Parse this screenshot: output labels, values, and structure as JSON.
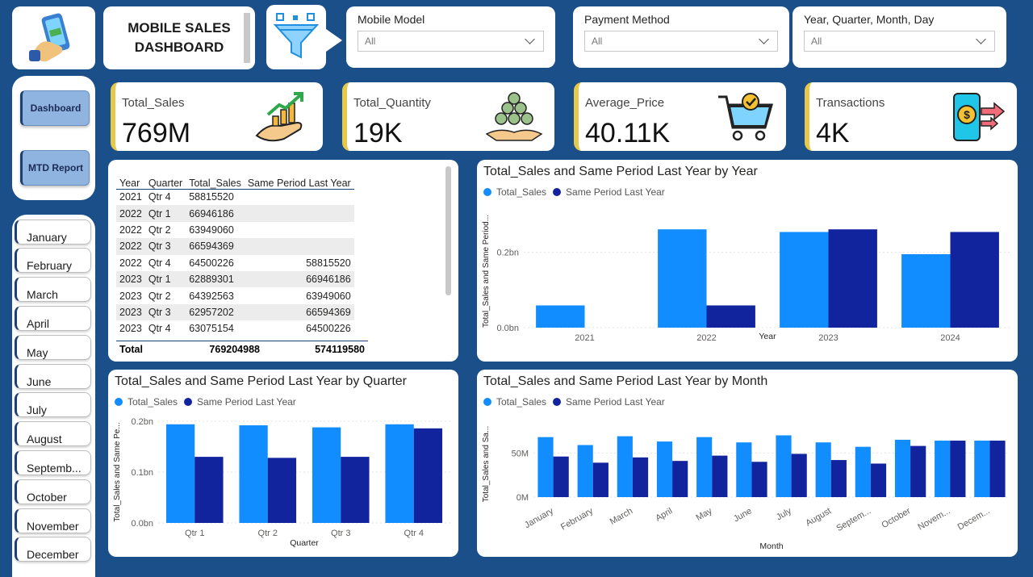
{
  "header": {
    "title_line1": "MOBILE SALES",
    "title_line2": "DASHBOARD"
  },
  "slicers": [
    {
      "label": "Mobile Model",
      "value": "All"
    },
    {
      "label": "Payment Method",
      "value": "All"
    },
    {
      "label": "Year, Quarter, Month, Day",
      "value": "All"
    }
  ],
  "nav": {
    "dashboard_label": "Dashboard",
    "mtd_label": "MTD Report"
  },
  "months": [
    "January",
    "February",
    "March",
    "April",
    "May",
    "June",
    "July",
    "August",
    "Septemb...",
    "October",
    "November",
    "December"
  ],
  "kpis": [
    {
      "label": "Total_Sales",
      "value": "769M",
      "icon": "hand-growth-icon"
    },
    {
      "label": "Total_Quantity",
      "value": "19K",
      "icon": "coins-stack-icon"
    },
    {
      "label": "Average_Price",
      "value": "40.11K",
      "icon": "shopping-cart-icon"
    },
    {
      "label": "Transactions",
      "value": "4K",
      "icon": "mobile-payment-icon"
    }
  ],
  "table": {
    "columns": [
      "Year",
      "Quarter",
      "Total_Sales",
      "Same Period Last Year"
    ],
    "rows": [
      [
        "2021",
        "Qtr 4",
        "58815520",
        ""
      ],
      [
        "2022",
        "Qtr 1",
        "66946186",
        ""
      ],
      [
        "2022",
        "Qtr 2",
        "63949060",
        ""
      ],
      [
        "2022",
        "Qtr 3",
        "66594369",
        ""
      ],
      [
        "2022",
        "Qtr 4",
        "64500226",
        "58815520"
      ],
      [
        "2023",
        "Qtr 1",
        "62889301",
        "66946186"
      ],
      [
        "2023",
        "Qtr 2",
        "64392563",
        "63949060"
      ],
      [
        "2023",
        "Qtr 3",
        "62957202",
        "66594369"
      ],
      [
        "2023",
        "Qtr 4",
        "63075154",
        "64500226"
      ]
    ],
    "total_label": "Total",
    "total_sales": "769204988",
    "total_last_year": "574119580"
  },
  "legend": {
    "series1": "Total_Sales",
    "series2": "Same Period Last Year"
  },
  "colors": {
    "series1": "#118dff",
    "series2": "#12239e",
    "accent": "#e6c84a",
    "background": "#1a4f8a"
  },
  "chart_data": [
    {
      "type": "bar",
      "title": "Total_Sales and Same Period Last Year by Year",
      "xlabel": "Year",
      "ylabel": "Total_Sales and Same Period...",
      "categories": [
        "2021",
        "2022",
        "2023",
        "2024"
      ],
      "yticks": [
        "0.0bn",
        "0.2bn"
      ],
      "ylim": [
        0,
        0.3
      ],
      "series": [
        {
          "name": "Total_Sales",
          "values": [
            0.059,
            0.261,
            0.254,
            0.195
          ]
        },
        {
          "name": "Same Period Last Year",
          "values": [
            0,
            0.059,
            0.261,
            0.254
          ]
        }
      ]
    },
    {
      "type": "bar",
      "title": "Total_Sales and Same Period Last Year by Quarter",
      "xlabel": "Quarter",
      "ylabel": "Total_Sales and Same Pe...",
      "categories": [
        "Qtr 1",
        "Qtr 2",
        "Qtr 3",
        "Qtr 4"
      ],
      "yticks": [
        "0.0bn",
        "0.1bn",
        "0.2bn"
      ],
      "ylim": [
        0,
        0.2
      ],
      "series": [
        {
          "name": "Total_Sales",
          "values": [
            0.194,
            0.192,
            0.188,
            0.194
          ]
        },
        {
          "name": "Same Period Last Year",
          "values": [
            0.13,
            0.128,
            0.13,
            0.186
          ]
        }
      ]
    },
    {
      "type": "bar",
      "title": "Total_Sales and Same Period Last Year by Month",
      "xlabel": "Month",
      "ylabel": "Total_Sales and Sa...",
      "categories": [
        "January",
        "February",
        "March",
        "April",
        "May",
        "June",
        "July",
        "August",
        "Septem...",
        "October",
        "Novem...",
        "Decem..."
      ],
      "yticks": [
        "0M",
        "50M"
      ],
      "ylim": [
        0,
        75
      ],
      "series": [
        {
          "name": "Total_Sales",
          "values": [
            68,
            59,
            69,
            63,
            68,
            62,
            70,
            62,
            57,
            65,
            64,
            64
          ]
        },
        {
          "name": "Same Period Last Year",
          "values": [
            46,
            39,
            45,
            41,
            47,
            40,
            49,
            42,
            38,
            58,
            64,
            64
          ]
        }
      ]
    }
  ]
}
